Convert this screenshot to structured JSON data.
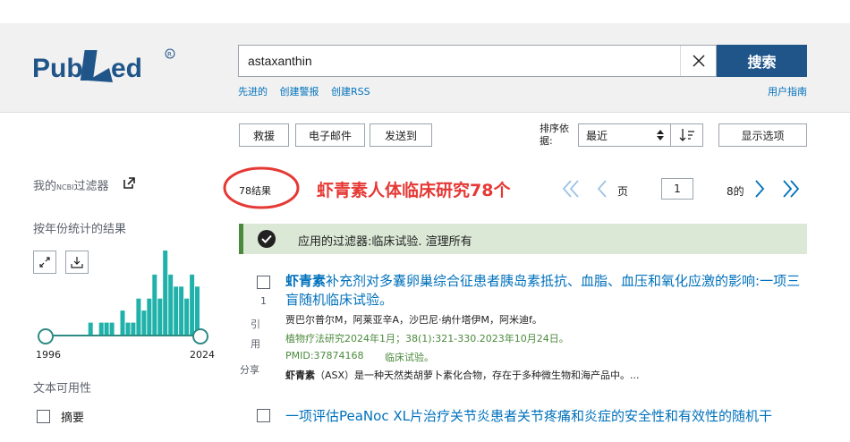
{
  "header": {
    "logo_text": "PubMed",
    "search_value": "astaxanthin",
    "search_button": "搜索",
    "sub_links": [
      "先进的",
      "创建警报",
      "创建RSS"
    ],
    "user_guide": "用户指南"
  },
  "toolbar": {
    "save": "救援",
    "email": "电子邮件",
    "send_to": "发送到",
    "sort_label": "排序依据:",
    "sort_value": "最近",
    "display_options": "显示选项"
  },
  "sidebar": {
    "my_filters_a": "我的",
    "my_filters_ncbi": "NCBI",
    "my_filters_b": "过滤器",
    "year_title": "按年份统计的结果",
    "year_start": "1996",
    "year_end": "2024",
    "text_availability": "文本可用性",
    "abstract_filter": "摘要"
  },
  "results": {
    "count": "78结果",
    "annotation": "虾青素人体临床研究78个",
    "page_label": "页",
    "page_value": "1",
    "page_of": "8的",
    "filter_banner": "应用的过滤器:临床试验. 渲理所有",
    "items": [
      {
        "number": "1",
        "title_bold": "虾青素",
        "title_rest": "补充剂对多囊卵巢综合征患者胰岛素抵抗、血脂、血压和氧化应激的影响:一项三盲随机临床试验。",
        "authors": "贾巴尔普尔M，阿莱亚辛A，沙巴尼·纳什塔伊M，阿米迪f。",
        "journal": "植物疗法研究2024年1月；38(1):321-330.2023年10月24日。",
        "pmid": "PMID:37874168",
        "article_type": "临床试验。",
        "snippet_bold": "虾青素",
        "snippet_rest": "（ASX）是一种天然类胡萝卜素化合物，存在于多种微生物和海产品中。...",
        "cite": "引",
        "cite2": "用",
        "share": "分享"
      },
      {
        "title": "一项评估PeaNoc XL片治疗关节炎患者关节疼痛和炎症的安全性和有效性的随机干"
      }
    ]
  },
  "chart_data": {
    "type": "bar",
    "x": [
      1996,
      1997,
      1998,
      1999,
      2000,
      2001,
      2002,
      2003,
      2004,
      2005,
      2006,
      2007,
      2008,
      2009,
      2010,
      2011,
      2012,
      2013,
      2014,
      2015,
      2016,
      2017,
      2018,
      2019,
      2020,
      2021,
      2022,
      2023,
      2024
    ],
    "values": [
      0,
      0,
      0,
      0,
      0,
      0,
      0,
      0,
      1,
      0,
      1,
      1,
      1,
      0,
      2,
      1,
      1,
      3,
      2,
      3,
      5,
      3,
      7,
      5,
      4,
      4,
      3,
      5,
      4
    ],
    "xlabel": "",
    "ylabel": "",
    "ylim": [
      0,
      7
    ]
  },
  "colors": {
    "bar": "#20b2aa",
    "primary": "#20558a",
    "link": "#0071bc",
    "annotation": "#e53935",
    "banner": "#dbe8d6"
  }
}
